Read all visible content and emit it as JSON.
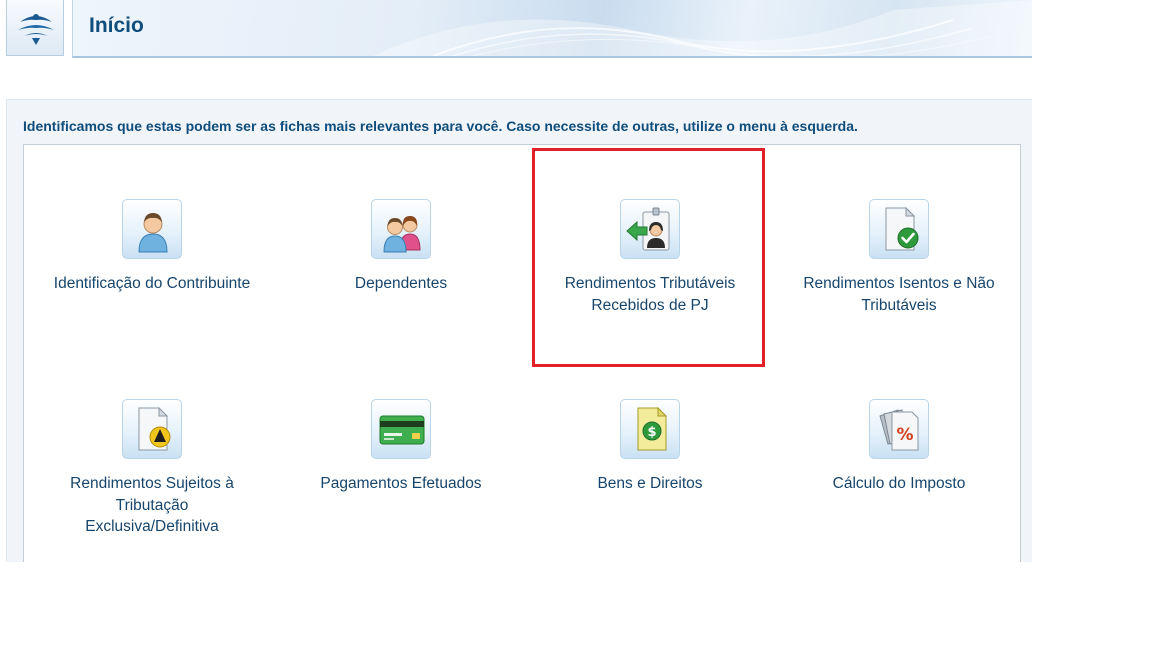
{
  "header": {
    "title": "Início",
    "logo_icon": "receita-federal-logo-icon"
  },
  "main": {
    "intro_text": "Identificamos que estas podem ser as fichas mais relevantes para você. Caso necessite de outras, utilize o menu à esquerda.",
    "tiles": [
      {
        "label": "Identificação do Contribuinte",
        "icon": "person-icon"
      },
      {
        "label": "Dependentes",
        "icon": "family-icon"
      },
      {
        "label": "Rendimentos Tributáveis Recebidos de PJ",
        "icon": "badge-arrow-icon"
      },
      {
        "label": "Rendimentos Isentos e Não Tributáveis",
        "icon": "document-check-icon"
      },
      {
        "label": "Rendimentos Sujeitos à Tributação Exclusiva/Definitiva",
        "icon": "document-warning-icon"
      },
      {
        "label": "Pagamentos Efetuados",
        "icon": "credit-card-icon"
      },
      {
        "label": "Bens e Direitos",
        "icon": "money-document-icon"
      },
      {
        "label": "Cálculo do Imposto",
        "icon": "percent-documents-icon"
      }
    ]
  },
  "colors": {
    "accent": "#0f4d7d",
    "highlight": "#e2202a"
  }
}
